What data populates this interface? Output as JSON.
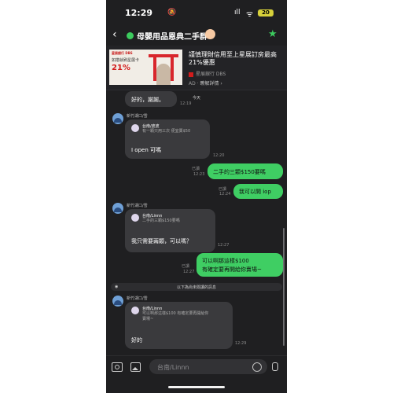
{
  "status": {
    "time": "12:29",
    "bell": "🔕",
    "signal": "ıll",
    "wifi": "ᯤ",
    "battery": "20"
  },
  "header": {
    "back": "‹",
    "title": "母嬰用品恩典二手群",
    "star": "★"
  },
  "ad": {
    "brand": "星展銀行 DBS",
    "promo_line": "如搭就刷星展卡",
    "promo_big": "21%",
    "title": "謹慎理財信用至上星展訂房最高21%優惠",
    "bank": "星展銀行 DBS",
    "ad_label": "AD · ",
    "link": "瞭解詳情 ›"
  },
  "messages": {
    "m0": {
      "text": "好的，謝謝。",
      "date": "今天",
      "time": "12:19"
    },
    "m1": {
      "sender": "新竹湖口/雪",
      "quote_name": "台南/皮皮",
      "quote_text": "有一顆只用三次 便宜賣$50",
      "text": "I open 可嗎",
      "time": "12:20"
    },
    "m2": {
      "read": "已讀",
      "time": "12:23",
      "text": "二手的三顆$150要嗎"
    },
    "m3": {
      "read": "已讀",
      "time": "12:24",
      "text": "我可以開 iop"
    },
    "m4": {
      "sender": "新竹湖口/雪",
      "quote_name": "台南/Linnn",
      "quote_text": "二手的三顆$150要嗎",
      "text": "我只需要兩顆，可以嗎？",
      "time": "12:27"
    },
    "m5": {
      "read": "已讀",
      "time": "12:27",
      "line1": "可以啊那這樣$100",
      "line2": "有確定要再開給你賣場~"
    },
    "unread": {
      "text": "以下為尚未閱讀的訊息"
    },
    "m6": {
      "sender": "新竹湖口/雪",
      "quote_name": "台南/Linnn",
      "quote_line1": "可以啊那這樣$100 有確定要再開給你",
      "quote_line2": "賣場~",
      "text": "好的",
      "time": "12:29"
    }
  },
  "input": {
    "placeholder": "台南/Linnn"
  }
}
